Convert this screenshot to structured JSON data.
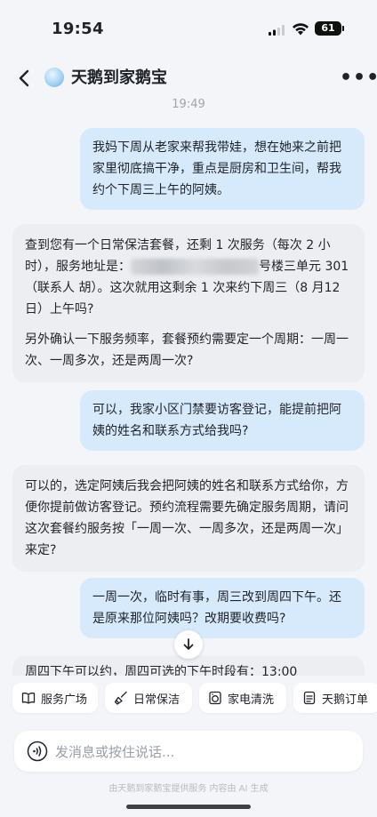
{
  "status_bar": {
    "time": "19:54",
    "battery": "61"
  },
  "header": {
    "title": "天鹅到家鹅宝",
    "more": "•••"
  },
  "timestamp": "19:49",
  "messages": [
    {
      "role": "user",
      "text": "我妈下周从老家来帮我带娃，想在她来之前把家里彻底搞干净，重点是厨房和卫生间，帮我约个下周三上午的阿姨。"
    },
    {
      "role": "bot",
      "p1_before": "查到您有一个日常保洁套餐，还剩 1 次服务（每次 2 小时），服务地址是：",
      "p1_after": "号楼三单元 301（联系人 胡）。这次就用这剩余 1 次来约下周三（8 月12日）上午吗?",
      "p2": "另外确认一下服务频率，套餐预约需要定一个周期：一周一次、一周多次，还是两周一次?"
    },
    {
      "role": "user",
      "text": "可以，我家小区门禁要访客登记，能提前把阿姨的姓名和联系方式给我吗?"
    },
    {
      "role": "bot",
      "text": "可以的，选定阿姨后我会把阿姨的姓名和联系方式给你，方便你提前做访客登记。预约流程需要先确定服务周期，请问这次套餐约服务按「一周一次、一周多次，还是两周一次」来定?"
    },
    {
      "role": "user",
      "text": "一周一次，临时有事，周三改到周四下午。还是原来那位阿姨吗？改期要收费吗?"
    },
    {
      "role": "bot",
      "text": "周四下午可以约，周四可选的下午时段有：13:00"
    }
  ],
  "quick_actions": [
    "服务广场",
    "日常保洁",
    "家电清洗",
    "天鹅订单"
  ],
  "input": {
    "placeholder": "发消息或按住说话..."
  },
  "disclaimer": "由天鹅到家鹅宝提供服务 内容由 AI 生成"
}
